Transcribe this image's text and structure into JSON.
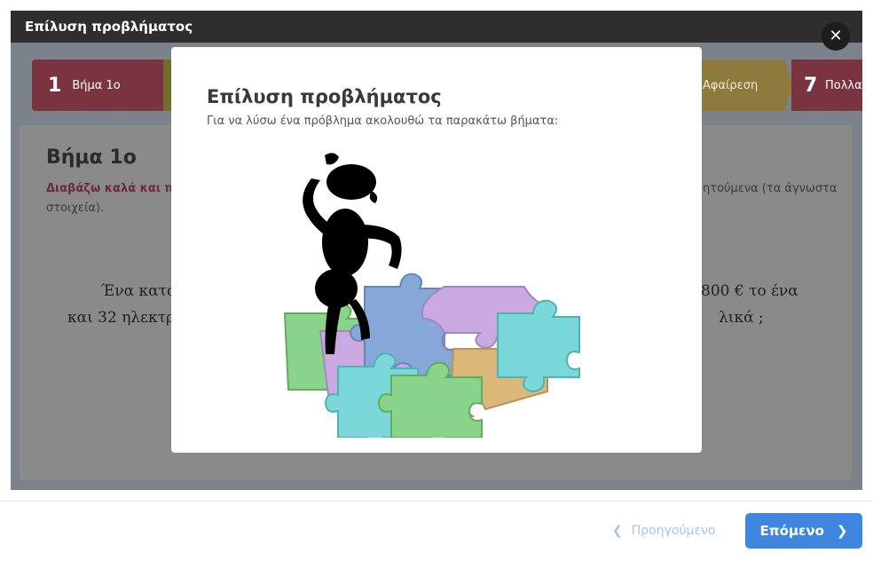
{
  "window": {
    "title": "Επίλυση προβλήματος"
  },
  "steps": [
    {
      "number": "1",
      "label": "Βήμα 1ο"
    },
    {
      "number": "",
      "label": "Αφαίρεση"
    },
    {
      "number": "7",
      "label": "Πολλα"
    }
  ],
  "card": {
    "title": "Βήμα 1ο",
    "instruction": "Διαβάζω καλά και π",
    "right_text_1": "ητούμενα (τα άγνωστα",
    "right_text_2": "στοιχεία).",
    "problem_left_1": "Ένα κατα",
    "problem_left_2": "και 32 ηλεκτρ",
    "problem_right_1": "800 € το ένα",
    "problem_right_2": "λικά ;"
  },
  "modal": {
    "title": "Επίλυση προβλήματος",
    "description": "Για να λύσω ένα πρόβλημα ακολουθώ τα παρακάτω βήματα:",
    "illustration_icon": "thinking-person-puzzle-icon"
  },
  "close_icon": "close-icon",
  "footer": {
    "prev_label": "Προηγούμενο",
    "next_label": "Επόμενο"
  },
  "colors": {
    "titlebar": "#2e2e2e",
    "overlay": "#7b8289",
    "step_red": "#7a3440",
    "step_olive": "#6f6f2a",
    "step_gold": "#8d7a3c",
    "next_button": "#3e86e0",
    "prev_button_text": "#a9c3e8",
    "puzzle_purple": "#c9a9e0",
    "puzzle_blue": "#86a7d8",
    "puzzle_teal": "#7ad8d8",
    "puzzle_green": "#8ad38a",
    "puzzle_tan": "#dcb77a"
  }
}
